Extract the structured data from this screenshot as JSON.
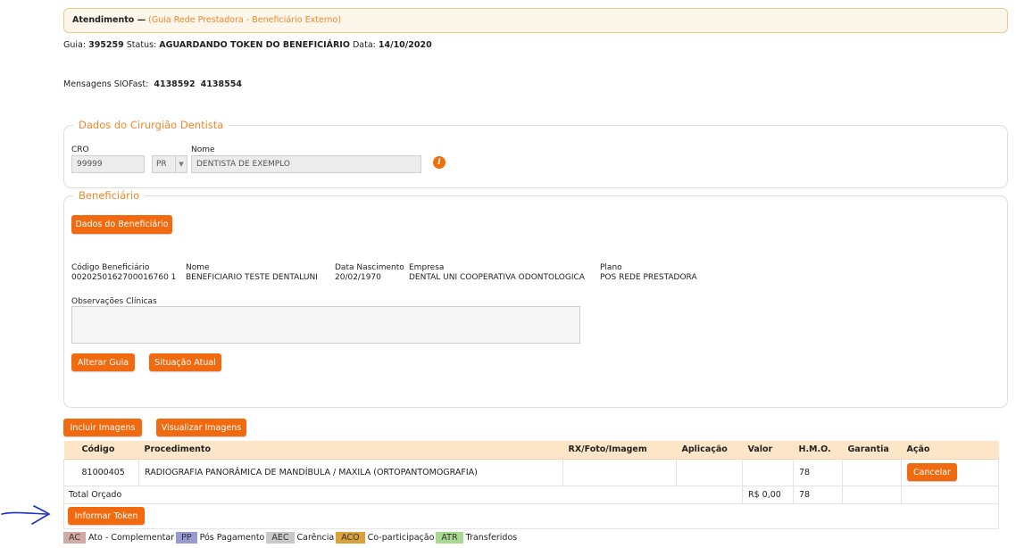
{
  "header": {
    "title": "Atendimento —",
    "subtitle": "(Guia Rede Prestadora - Beneficiário Externo)"
  },
  "guide_info": {
    "guia_label": "Guia:",
    "guia_value": "395259",
    "status_label": "Status:",
    "status_value": "AGUARDANDO TOKEN DO BENEFICIÁRIO",
    "data_label": "Data:",
    "data_value": "14/10/2020"
  },
  "messages": {
    "label": "Mensagens SIOFast:",
    "value1": "4138592",
    "value2": "4138554"
  },
  "dentist": {
    "legend": "Dados do Cirurgião Dentista",
    "cro_label": "CRO",
    "cro_value": "99999",
    "uf_value": "PR",
    "name_label": "Nome",
    "name_value": "DENTISTA DE EXEMPLO",
    "info_icon": "i"
  },
  "beneficiary": {
    "legend": "Beneficiário",
    "dados_button": "Dados do Beneficiário",
    "codigo_label": "Código Beneficiário",
    "codigo_value": "0020250162700016760 1",
    "nome_label": "Nome",
    "nome_value": "BENEFICIARIO TESTE DENTALUNI",
    "nasc_label": "Data Nascimento",
    "nasc_value": "20/02/1970",
    "empresa_label": "Empresa",
    "empresa_value": "DENTAL UNI COOPERATIVA ODONTOLOGICA",
    "plano_label": "Plano",
    "plano_value": "POS REDE PRESTADORA",
    "obs_label": "Observações Clínicas",
    "alterar_button": "Alterar Guia",
    "situacao_button": "Situação Atual"
  },
  "images": {
    "incluir_button": "Incluir Imagens",
    "visualizar_button": "Visualizar Imagens"
  },
  "table": {
    "headers": [
      "Código",
      "Procedimento",
      "RX/Foto/Imagem",
      "Aplicação",
      "Valor",
      "H.M.O.",
      "Garantia",
      "Ação"
    ],
    "rows": [
      {
        "codigo": "81000405",
        "procedimento": "RADIOGRAFIA PANORÂMICA DE MANDÍBULA / MAXILA (ORTOPANTOMOGRAFIA)",
        "rx": "",
        "aplicacao": "",
        "valor": "",
        "hmo": "78",
        "garantia": "",
        "acao": "Cancelar"
      }
    ],
    "total_label": "Total Orçado",
    "total_valor": "R$ 0,00",
    "total_hmo": "78",
    "token_button": "Informar Token"
  },
  "legend": [
    {
      "code": "AC",
      "label": "Ato - Complementar",
      "color": "#d2aaa4"
    },
    {
      "code": "PP",
      "label": "Pós Pagamento",
      "color": "#9a9ad2"
    },
    {
      "code": "AEC",
      "label": "Carência",
      "color": "#c8c8c8"
    },
    {
      "code": "ACO",
      "label": "Co-participação",
      "color": "#d9a23c"
    },
    {
      "code": "ATR",
      "label": "Transferidos",
      "color": "#a7d98e"
    }
  ],
  "colors": {
    "accent": "#f26a10",
    "header_bg": "#fdf6ea",
    "table_header_bg": "#fde6c8",
    "annotation": "#1a2cc8"
  }
}
